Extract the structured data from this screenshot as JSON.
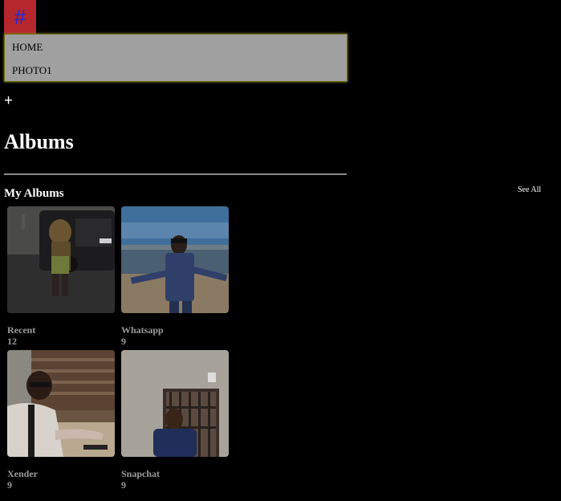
{
  "menu": {
    "toggle_glyph": "#",
    "items": [
      {
        "label": "HOME"
      },
      {
        "label": "PHOTO1"
      }
    ]
  },
  "add_glyph": "+",
  "page_title": "Albums",
  "my_albums": {
    "title": "My Albums",
    "see_all": "See All",
    "albums": [
      {
        "name": "Recent",
        "count": "12"
      },
      {
        "name": "Whatsapp",
        "count": "9"
      },
      {
        "name": "Xender",
        "count": "9"
      },
      {
        "name": "Snapchat",
        "count": "9"
      }
    ]
  },
  "colors": {
    "background": "#000000",
    "menu_toggle_bg": "#b5262d",
    "menu_toggle_glyph": "#1d2bd8",
    "menu_bg": "#a0a0a0",
    "album_text": "#9a9a9a"
  }
}
